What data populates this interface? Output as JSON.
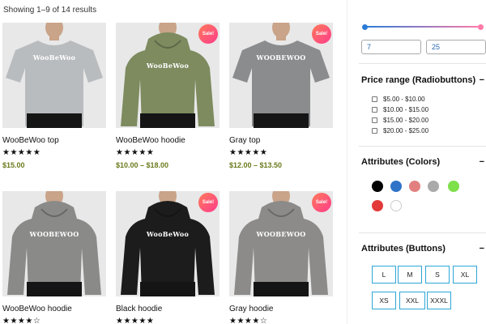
{
  "results_text": "Showing 1–9 of 14 results",
  "sale_label": "Sale!",
  "products": [
    {
      "name": "WooBeWoo top",
      "stars": "★★★★★",
      "price": "$15.00",
      "sale": false,
      "color": "#b9bcbf",
      "print": "WooBeWoo"
    },
    {
      "name": "WooBeWoo hoodie",
      "stars": "★★★★★",
      "price": "$10.00 – $18.00",
      "sale": true,
      "color": "#7d8b5f",
      "print": "WooBeWoo"
    },
    {
      "name": "Gray top",
      "stars": "★★★★★",
      "price": "$12.00 – $13.50",
      "sale": true,
      "color": "#8b8c8e",
      "print": "WOOBEWOO"
    },
    {
      "name": "WooBeWoo hoodie",
      "stars": "★★★★☆",
      "price": "",
      "sale": false,
      "color": "#8a8a89",
      "print": "WOOBEWOO"
    },
    {
      "name": "Black hoodie",
      "stars": "★★★★★",
      "price": "",
      "sale": true,
      "color": "#1c1c1c",
      "print": "WooBeWoo"
    },
    {
      "name": "Gray hoodie",
      "stars": "★★★★☆",
      "price": "",
      "sale": true,
      "color": "#8c8b8a",
      "print": "WOOBEWOO"
    }
  ],
  "filters": {
    "price_min": "7",
    "price_max": "25",
    "price_radio": {
      "title": "Price range (Radiobuttons)",
      "options": [
        "$5.00 - $10.00",
        "$10.00 - $15.00",
        "$15.00 - $20.00",
        "$20.00 - $25.00"
      ]
    },
    "colors": {
      "title": "Attributes (Colors)",
      "swatches": [
        "#000000",
        "#2f74c8",
        "#e28080",
        "#aaaaaa",
        "#7ee04a",
        "#e23a3a",
        "#ffffff"
      ]
    },
    "sizes": {
      "title": "Attributes (Buttons)",
      "options": [
        "L",
        "M",
        "S",
        "XL",
        "XS",
        "XXL",
        "XXXL"
      ]
    },
    "collapse_symbol": "−"
  },
  "colors": {
    "accent": "#2b7bd6",
    "price": "#6b7a1c",
    "size_border": "#2ea6d6"
  }
}
